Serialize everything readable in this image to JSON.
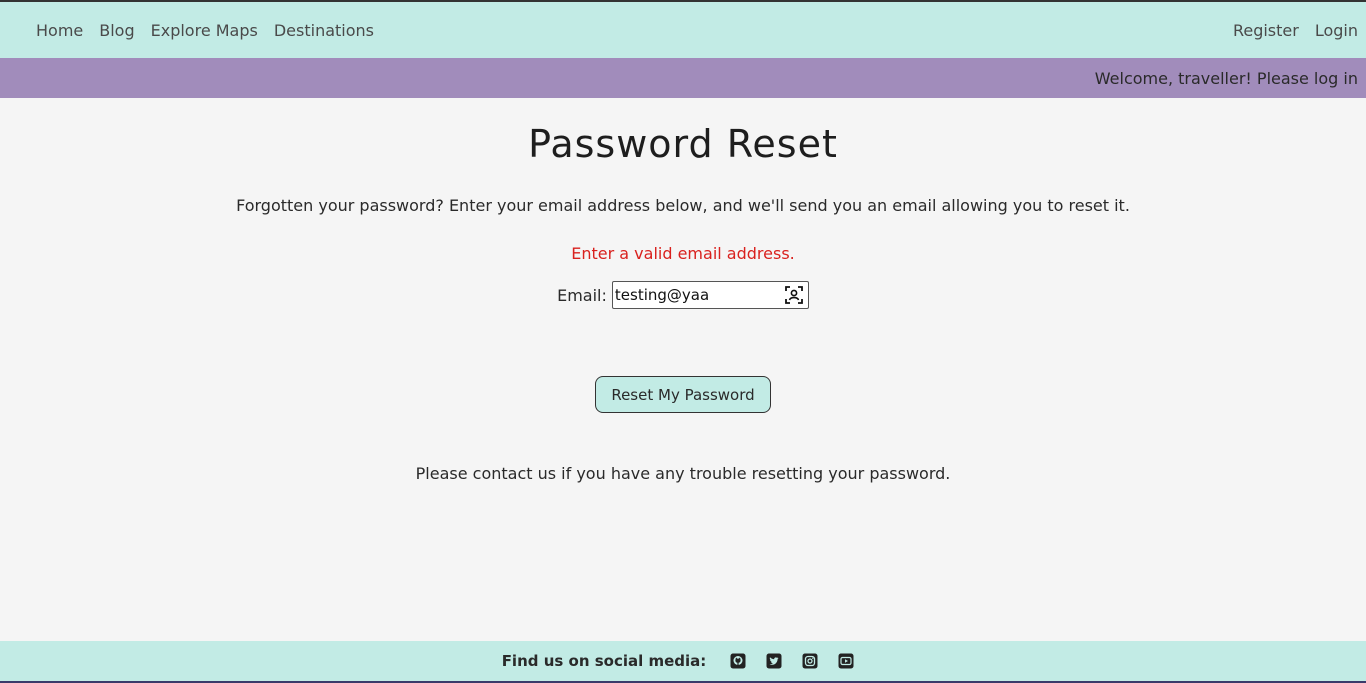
{
  "nav": {
    "left": [
      "Home",
      "Blog",
      "Explore Maps",
      "Destinations"
    ],
    "right": [
      "Register",
      "Login"
    ]
  },
  "welcome": "Welcome, traveller! Please log in",
  "main": {
    "title": "Password Reset",
    "intro": "Forgotten your password? Enter your email address below, and we'll send you an email allowing you to reset it.",
    "error": "Enter a valid email address.",
    "email_label": "Email:",
    "email_value": "testing@yaa",
    "button_label": "Reset My Password",
    "contact_note": "Please contact us if you have any trouble resetting your password."
  },
  "footer": {
    "label": "Find us on social media:",
    "icons": [
      "github-icon",
      "twitter-icon",
      "instagram-icon",
      "youtube-icon"
    ]
  },
  "colors": {
    "nav_bg": "#c2ebe5",
    "welcome_bg": "#a18cbb",
    "page_bg": "#f5f5f5",
    "error": "#d9211e"
  }
}
